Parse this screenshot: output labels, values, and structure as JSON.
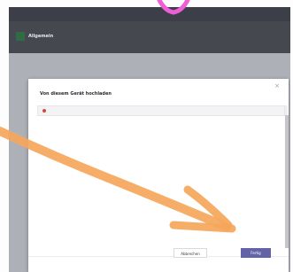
{
  "window": {
    "title": ""
  },
  "team": {
    "name": "Allgemein"
  },
  "header_tabs": [],
  "back_link": "",
  "modal": {
    "title": "Von diesem Gerät hochladen",
    "file": {
      "name": "",
      "status": ""
    },
    "cancel_label": "Abbrechen",
    "done_label": "Fertig",
    "close_icon": "close-icon"
  },
  "colors": {
    "accent": "#6264a7",
    "annotation_orange": "#f5a65b",
    "annotation_pink": "#ee5fd6"
  }
}
